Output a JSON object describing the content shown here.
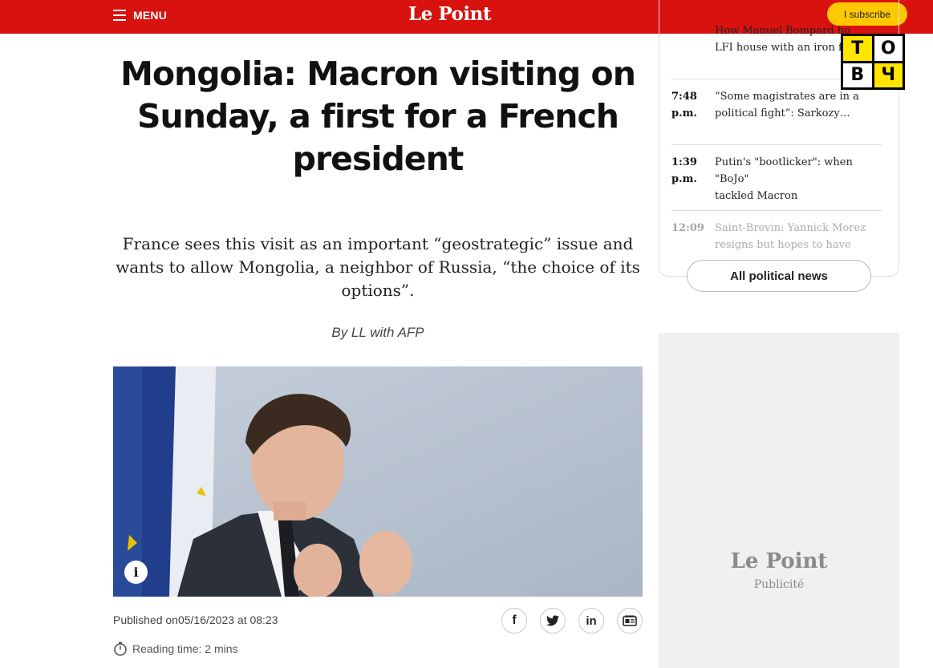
{
  "header": {
    "menu_label": "MENU",
    "logo": "Le Point",
    "subscribe_label": "I subscribe",
    "brand_red": "#d8120f",
    "accent_yellow": "#fdc800"
  },
  "article": {
    "headline": "Mongolia: Macron visiting on Sunday, a first for a French president",
    "standfirst": "France sees this visit as an important “geostrategic” issue and wants to allow Mongolia, a neighbor of Russia, “the choice of its options”.",
    "byline_prefix": "By ",
    "byline_author": "LL",
    "byline_suffix": " with AFP",
    "photo_description_icon": "info-icon",
    "info_glyph": "i",
    "published": "Published on05/16/2023 at 08:23",
    "reading_time": "Reading time: 2 mins",
    "share": {
      "facebook_glyph": "f",
      "twitter_icon": "twitter-icon",
      "linkedin_glyph": "in",
      "gnews_icon": "google-news-icon"
    }
  },
  "sidebar": {
    "feed": [
      {
        "time": "",
        "title": "How Manuel Bompard ho… LFI house with an iron fis…",
        "line1": "How Manuel Bompard ho",
        "line2": "LFI house with an iron fis"
      },
      {
        "time": "7:48 p.m.",
        "time1": "7:48",
        "time2": "p.m.",
        "line1": "“Some magistrates are in a",
        "line2": "political fight”: Sarkozy…"
      },
      {
        "time": "1:39 p.m.",
        "time1": "1:39",
        "time2": "p.m.",
        "line1": "Putin's \"bootlicker\": when \"BoJo\"",
        "line2": "tackled Macron"
      },
      {
        "time": "12:09",
        "time1": "12:09",
        "time2": "",
        "line1": "Saint-Brevin: Yannick Morez",
        "line2": "resigns but hopes to have"
      }
    ],
    "all_news_label": "All political news",
    "ad_logo": "Le Point",
    "ad_label": "Publicité"
  },
  "watermark": {
    "letters": [
      "Т",
      "О",
      "В",
      "Ч"
    ]
  }
}
